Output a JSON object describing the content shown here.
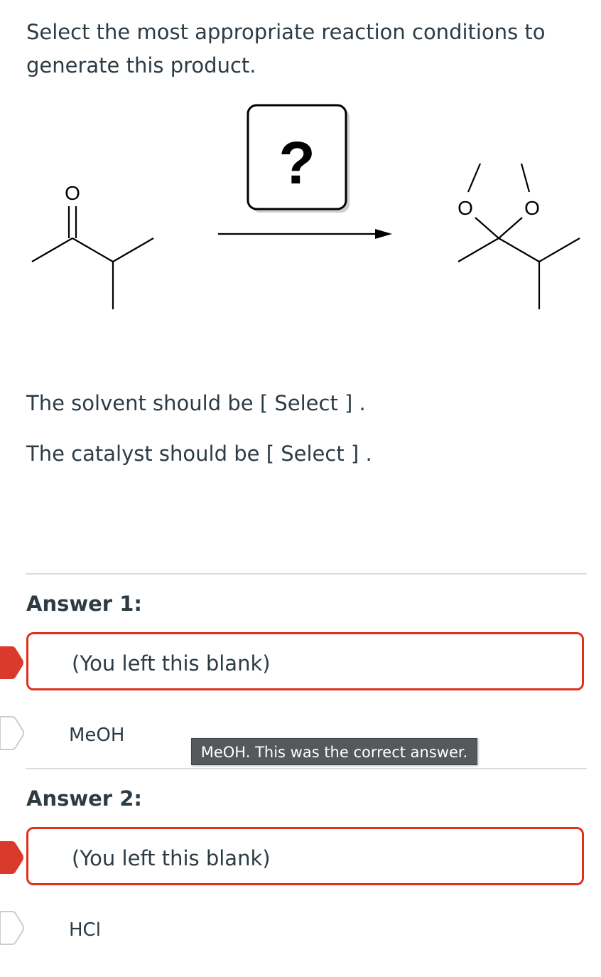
{
  "question": {
    "text": "Select the most appropriate reaction conditions to generate this product."
  },
  "scheme": {
    "reagent_placeholder": "?",
    "reactant_atom_label": "O",
    "product_atom_label_left": "O",
    "product_atom_label_right": "O"
  },
  "prompts": {
    "solvent_prefix": "The solvent should be ",
    "solvent_select": "[ Select ]",
    "solvent_suffix": " .",
    "catalyst_prefix": "The catalyst should be ",
    "catalyst_select": "[ Select ]",
    "catalyst_suffix": " ."
  },
  "answers": [
    {
      "heading": "Answer 1:",
      "user_answer": "(You left this blank)",
      "correct_option": "MeOH",
      "tooltip": "MeOH. This was the correct answer."
    },
    {
      "heading": "Answer 2:",
      "user_answer": "(You left this blank)",
      "correct_option": "HCl"
    }
  ],
  "colors": {
    "incorrect_red": "#e0311f",
    "text": "#2d3b45",
    "tooltip_bg": "#55595c"
  }
}
